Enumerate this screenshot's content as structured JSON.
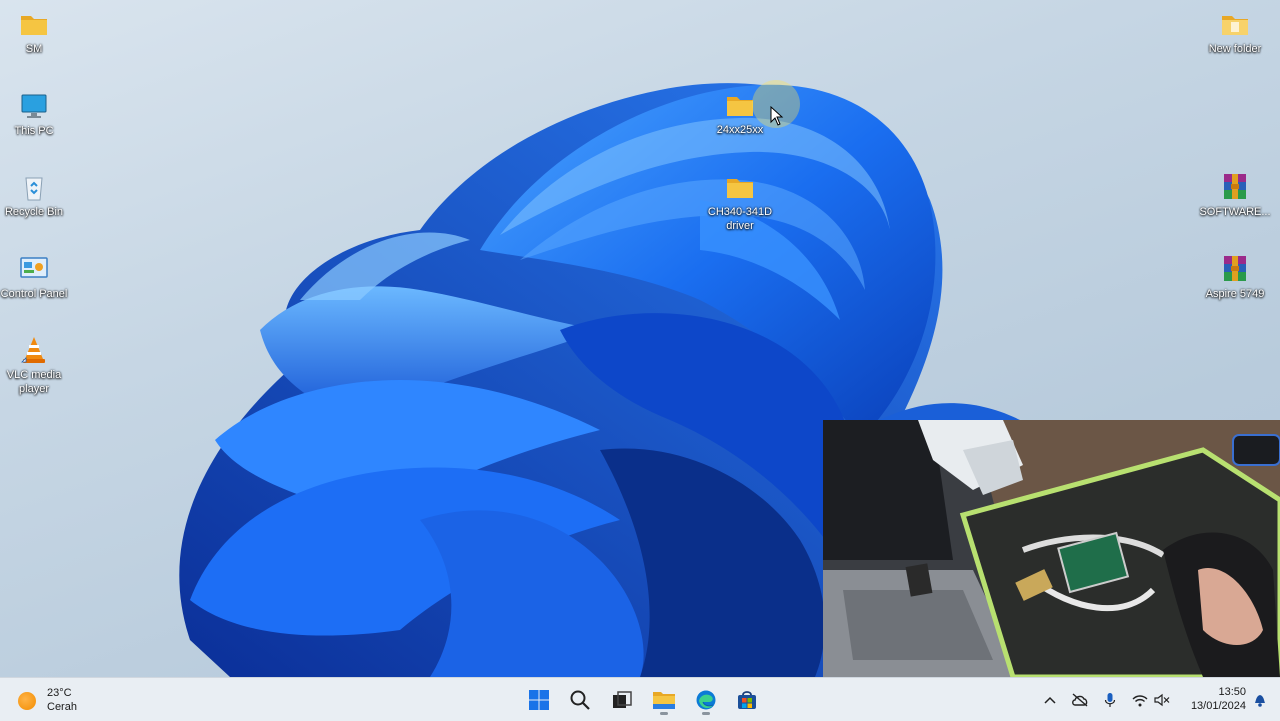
{
  "desktop": {
    "left_icons": [
      {
        "label": "SM",
        "icon": "folder-icon"
      },
      {
        "label": "This PC",
        "icon": "monitor-icon"
      },
      {
        "label": "Recycle Bin",
        "icon": "recycle-bin-icon"
      },
      {
        "label": "Control Panel",
        "icon": "control-panel-icon"
      },
      {
        "label": "VLC media player",
        "icon": "vlc-icon"
      }
    ],
    "center_icons": [
      {
        "label": "24xx25xx",
        "icon": "folder-icon"
      },
      {
        "label": "CH340-341D driver",
        "icon": "folder-icon"
      }
    ],
    "right_icons": [
      {
        "label": "New folder",
        "icon": "folder-icon"
      },
      {
        "label": "SOFTWARE...",
        "icon": "winrar-icon"
      },
      {
        "label": "Aspire 5749",
        "icon": "winrar-icon"
      }
    ]
  },
  "taskbar": {
    "weather": {
      "temp": "23°C",
      "condition": "Cerah"
    },
    "apps": [
      {
        "name": "start",
        "icon": "windows-start-icon"
      },
      {
        "name": "search",
        "icon": "search-icon"
      },
      {
        "name": "task-view",
        "icon": "task-view-icon"
      },
      {
        "name": "file-explorer",
        "icon": "file-explorer-icon"
      },
      {
        "name": "edge",
        "icon": "edge-icon"
      },
      {
        "name": "store",
        "icon": "store-icon"
      }
    ],
    "tray": {
      "icons": [
        "chevron-up-icon",
        "onedrive-offline-icon",
        "microphone-icon",
        "wifi-icon",
        "speaker-muted-icon",
        "notification-bell-icon"
      ],
      "time": "13:50",
      "date": "13/01/2024"
    }
  },
  "colors": {
    "accent_blue": "#1565e0",
    "folder_yellow": "#f5c542",
    "taskbar_bg": "#e9eef3"
  }
}
